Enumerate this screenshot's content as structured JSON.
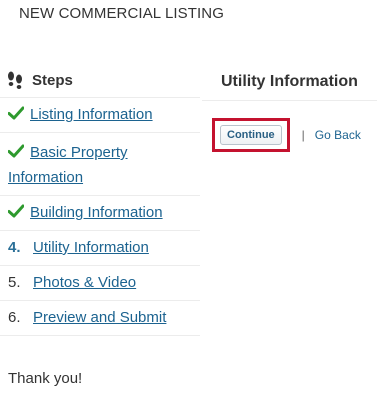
{
  "page": {
    "title": "NEW COMMERCIAL LISTING"
  },
  "steps_panel": {
    "header": "Steps",
    "items": [
      {
        "status": "done",
        "label": "Listing Information"
      },
      {
        "status": "done",
        "label_line1": "Basic Property",
        "label_line2": "Information"
      },
      {
        "status": "done",
        "label": "Building Information"
      },
      {
        "status": "current",
        "number": "4.",
        "label": "Utility Information"
      },
      {
        "status": "pending",
        "number": "5.",
        "label": "Photos & Video"
      },
      {
        "status": "pending",
        "number": "6.",
        "label": "Preview and Submit"
      }
    ],
    "footer": "Thank you!"
  },
  "main": {
    "title": "Utility Information",
    "continue_label": "Continue",
    "separator": "|",
    "go_back_label": "Go Back"
  },
  "colors": {
    "link": "#1c6390",
    "check": "#2e9a2e",
    "highlight": "#c4122f"
  },
  "icons": {
    "steps_header": "footprints-icon",
    "done": "checkmark-icon"
  }
}
